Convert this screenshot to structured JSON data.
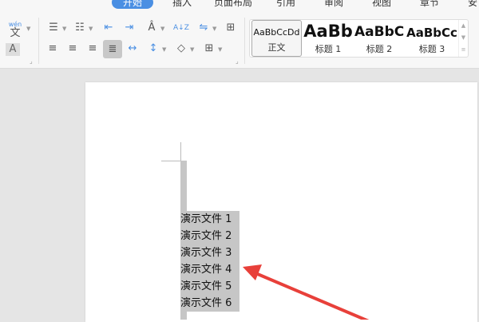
{
  "tabs": [
    {
      "label": "开始",
      "active": true
    },
    {
      "label": "插入"
    },
    {
      "label": "页面布局"
    },
    {
      "label": "引用"
    },
    {
      "label": "审阅"
    },
    {
      "label": "视图"
    },
    {
      "label": "章节"
    },
    {
      "label": "安"
    }
  ],
  "toolbar": {
    "phonetic_label": "wén",
    "phonetic_char": "文",
    "char_border": "A",
    "font_color": "A",
    "sort_label": "A↓Z"
  },
  "styles": [
    {
      "sample": "AaBbCcDd",
      "name": "正文"
    },
    {
      "sample": "AaBb",
      "name": "标题 1"
    },
    {
      "sample": "AaBbC",
      "name": "标题 2"
    },
    {
      "sample": "AaBbCc",
      "name": "标题 3"
    }
  ],
  "document": {
    "lines": [
      "演示文件 1",
      "演示文件 2",
      "演示文件 3",
      "演示文件 4",
      "演示文件 5",
      "演示文件 6"
    ]
  },
  "colors": {
    "accent": "#4a8fe3",
    "arrow": "#e8403a",
    "selection": "#c6c6c6"
  }
}
